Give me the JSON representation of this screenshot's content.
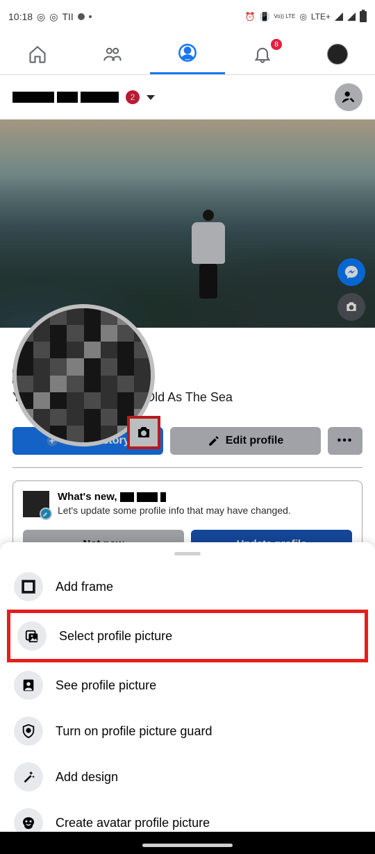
{
  "status": {
    "time": "10:18",
    "left_text": "TII",
    "lte": "LTE+",
    "volte": "Vo)) LTE"
  },
  "nav": {
    "notification_badge": "8"
  },
  "header": {
    "pages_badge": "2"
  },
  "bio": {
    "text": "Young As The Morning; Old As The Sea"
  },
  "actions": {
    "add_story": "Add to story",
    "edit_profile": "Edit profile"
  },
  "prompt": {
    "title_prefix": "What's new, ",
    "subtitle": "Let's update some profile info that may have changed.",
    "not_now": "Not now",
    "update": "Update profile"
  },
  "sheet": {
    "items": [
      {
        "label": "Add frame",
        "icon": "frame"
      },
      {
        "label": "Select profile picture",
        "icon": "image",
        "highlighted": true
      },
      {
        "label": "See profile picture",
        "icon": "portrait"
      },
      {
        "label": "Turn on profile picture guard",
        "icon": "shield"
      },
      {
        "label": "Add design",
        "icon": "wand"
      },
      {
        "label": "Create avatar profile picture",
        "icon": "avatar"
      }
    ]
  }
}
